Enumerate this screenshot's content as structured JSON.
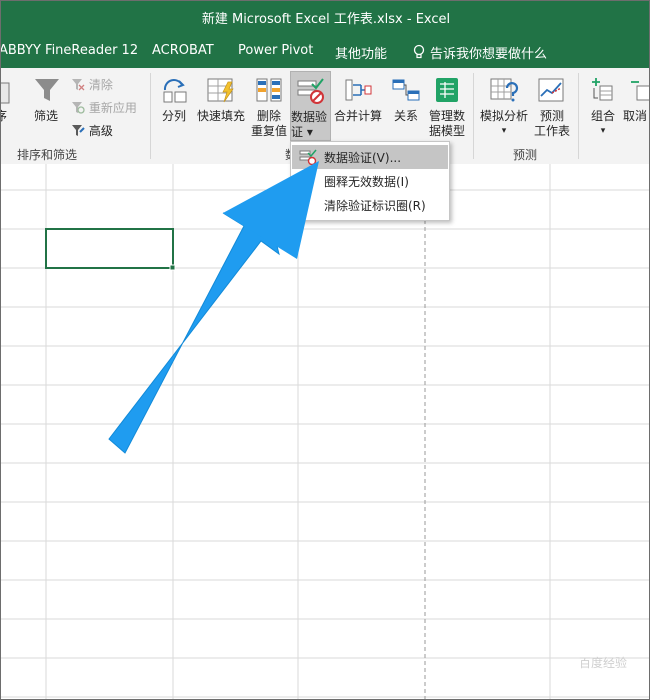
{
  "window": {
    "title": "新建 Microsoft Excel 工作表.xlsx  -  Excel"
  },
  "menubar": {
    "tabs": [
      "ABBYY FineReader 12",
      "ACROBAT",
      "Power Pivot",
      "其他功能"
    ],
    "tell_me": "告诉我你想要做什么"
  },
  "ribbon": {
    "sort_filter": {
      "sort_fragment": "序",
      "filter": "筛选",
      "clear": "清除",
      "reapply": "重新应用",
      "advanced": "高级",
      "group_label": "排序和筛选"
    },
    "data_tools": {
      "split": "分列",
      "flash_fill": "快速填充",
      "remove_dup_1": "删除",
      "remove_dup_2": "重复值",
      "validation_1": "数据验",
      "validation_2": "证 ▾",
      "consolidate": "合并计算",
      "relations": "关系",
      "manage_model_1": "管理数",
      "manage_model_2": "据模型",
      "group_label_fragment": "数"
    },
    "forecast": {
      "whatif": "模拟分析",
      "whatif_arrow": "▾",
      "sheet_1": "预测",
      "sheet_2": "工作表",
      "group_label": "预测"
    },
    "outline": {
      "group": "组合",
      "group_arrow": "▾",
      "ungroup": "取消"
    }
  },
  "dropdown": {
    "items": [
      {
        "label": "数据验证(V)..."
      },
      {
        "label": "圈释无效数据(I)"
      },
      {
        "label": "清除验证标识圈(R)"
      }
    ]
  },
  "watermark": "百度经验",
  "colors": {
    "excel_green": "#217346",
    "arrow_blue": "#1a9ff0",
    "selection_green": "#217346"
  }
}
